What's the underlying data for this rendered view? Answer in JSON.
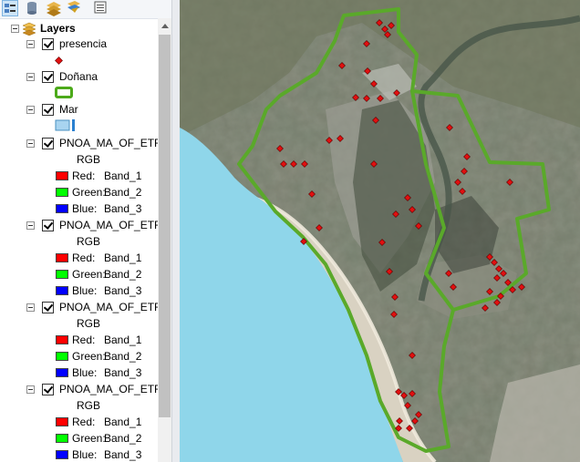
{
  "toc": {
    "root_label": "Layers",
    "layers": [
      {
        "label": "presencia",
        "symbol": "red-diamond"
      },
      {
        "label": "Doñana",
        "symbol": "green-outline-polygon"
      },
      {
        "label": "Mar",
        "symbol": "light-blue-fill"
      },
      {
        "label": "PNOA_MA_OF_ETRS",
        "sublabel": "RGB",
        "bands": [
          {
            "channel": "Red:",
            "band": "Band_1",
            "color": "#ff0000"
          },
          {
            "channel": "Green:",
            "band": "Band_2",
            "color": "#00ff00"
          },
          {
            "channel": "Blue:",
            "band": "Band_3",
            "color": "#0000ff"
          }
        ]
      },
      {
        "label": "PNOA_MA_OF_ETRS",
        "sublabel": "RGB",
        "bands": [
          {
            "channel": "Red:",
            "band": "Band_1",
            "color": "#ff0000"
          },
          {
            "channel": "Green:",
            "band": "Band_2",
            "color": "#00ff00"
          },
          {
            "channel": "Blue:",
            "band": "Band_3",
            "color": "#0000ff"
          }
        ]
      },
      {
        "label": "PNOA_MA_OF_ETRS",
        "sublabel": "RGB",
        "bands": [
          {
            "channel": "Red:",
            "band": "Band_1",
            "color": "#ff0000"
          },
          {
            "channel": "Green:",
            "band": "Band_2",
            "color": "#00ff00"
          },
          {
            "channel": "Blue:",
            "band": "Band_3",
            "color": "#0000ff"
          }
        ]
      },
      {
        "label": "PNOA_MA_OF_ETRS",
        "sublabel": "RGB",
        "bands": [
          {
            "channel": "Red:",
            "band": "Band_1",
            "color": "#ff0000"
          },
          {
            "channel": "Green:",
            "band": "Band_2",
            "color": "#00ff00"
          },
          {
            "channel": "Blue:",
            "band": "Band_3",
            "color": "#0000ff"
          }
        ]
      }
    ]
  },
  "colors": {
    "sea": "#8fd6ea",
    "boundary": "#5aa92a",
    "point": "#e01010",
    "mar_swatch": "#a8d4f0"
  },
  "icons": [
    "list-by-drawing-order-icon",
    "list-by-source-icon",
    "list-by-visibility-icon",
    "list-by-selection-icon",
    "options-icon"
  ]
}
